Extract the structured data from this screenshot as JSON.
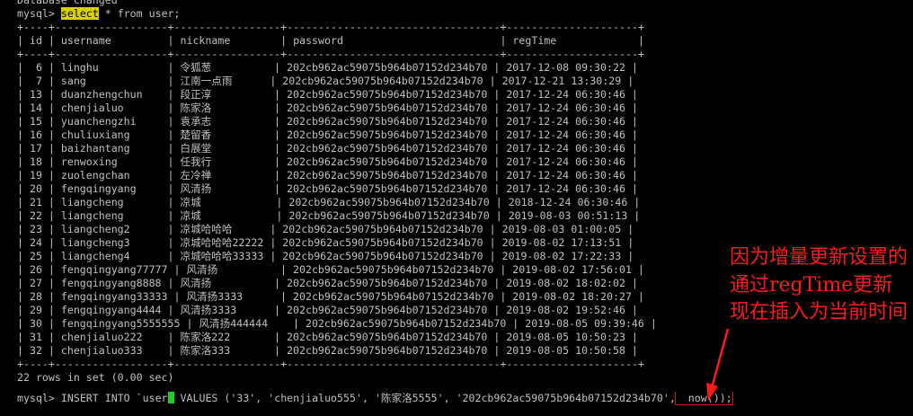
{
  "terminal": {
    "top_line": "Database changed",
    "prompt": "mysql> ",
    "query_keyword": "select",
    "query_rest": " * from user;",
    "border": "+----+------------------+-----------------+----------------------------------+---------------------+",
    "header": "| id | username         | nickname        | password                         | regTime             |",
    "rows": [
      "|  6 | linghu           | 令狐葱          | 202cb962ac59075b964b07152d234b70 | 2017-12-08 09:30:22 |",
      "|  7 | sang             | 江南一点雨      | 202cb962ac59075b964b07152d234b70 | 2017-12-21 13:30:29 |",
      "| 13 | duanzhengchun    | 段正淳          | 202cb962ac59075b964b07152d234b70 | 2017-12-24 06:30:46 |",
      "| 14 | chenjialuo       | 陈家洛          | 202cb962ac59075b964b07152d234b70 | 2017-12-24 06:30:46 |",
      "| 15 | yuanchengzhi     | 袁承志          | 202cb962ac59075b964b07152d234b70 | 2017-12-24 06:30:46 |",
      "| 16 | chuliuxiang      | 楚留香          | 202cb962ac59075b964b07152d234b70 | 2017-12-24 06:30:46 |",
      "| 17 | baizhantang      | 白展堂          | 202cb962ac59075b964b07152d234b70 | 2017-12-24 06:30:46 |",
      "| 18 | renwoxing        | 任我行          | 202cb962ac59075b964b07152d234b70 | 2017-12-24 06:30:46 |",
      "| 19 | zuolengchan      | 左冷禅          | 202cb962ac59075b964b07152d234b70 | 2017-12-24 06:30:46 |",
      "| 20 | fengqingyang     | 风清扬          | 202cb962ac59075b964b07152d234b70 | 2017-12-24 06:30:46 |",
      "| 21 | liangcheng       | 凉城            | 202cb962ac59075b964b07152d234b70 | 2018-12-24 06:30:46 |",
      "| 22 | liangcheng       | 凉城            | 202cb962ac59075b964b07152d234b70 | 2019-08-03 00:51:13 |",
      "| 23 | liangcheng2      | 凉城哈哈哈      | 202cb962ac59075b964b07152d234b70 | 2019-08-03 01:00:05 |",
      "| 24 | liangcheng3      | 凉城哈哈哈22222 | 202cb962ac59075b964b07152d234b70 | 2019-08-02 17:13:51 |",
      "| 25 | liangcheng4      | 凉城哈哈哈33333 | 202cb962ac59075b964b07152d234b70 | 2019-08-02 17:22:33 |",
      "| 26 | fengqingyang77777 | 风清扬          | 202cb962ac59075b964b07152d234b70 | 2019-08-02 17:56:01 |",
      "| 27 | fengqingyang8888 | 风清扬          | 202cb962ac59075b964b07152d234b70 | 2019-08-02 18:02:02 |",
      "| 28 | fengqingyang33333 | 风清扬3333      | 202cb962ac59075b964b07152d234b70 | 2019-08-02 18:20:27 |",
      "| 29 | fengqingyang4444 | 风清扬3333      | 202cb962ac59075b964b07152d234b70 | 2019-08-02 19:52:46 |",
      "| 30 | fengqingyang5555555 | 风清扬444444    | 202cb962ac59075b964b07152d234b70 | 2019-08-05 09:39:46 |",
      "| 31 | chenjialuo222    | 陈家洛222       | 202cb962ac59075b964b07152d234b70 | 2019-08-05 10:50:23 |",
      "| 32 | chenjialuo333    | 陈家洛333       | 202cb962ac59075b964b07152d234b70 | 2019-08-05 10:50:58 |"
    ],
    "result_summary": "22 rows in set (0.00 sec)",
    "insert_part1": "INSERT INTO `user",
    "insert_part2": " VALUES ('33', 'chenjialuo555', '陈家洛5555', '202cb962ac59075b964b07152d234b70',",
    "insert_boxed": "  now());"
  },
  "annotation": {
    "text": "因为增量更新设置的通过regTime更新 现在插入为当前时间",
    "color": "#ff1a1a"
  }
}
